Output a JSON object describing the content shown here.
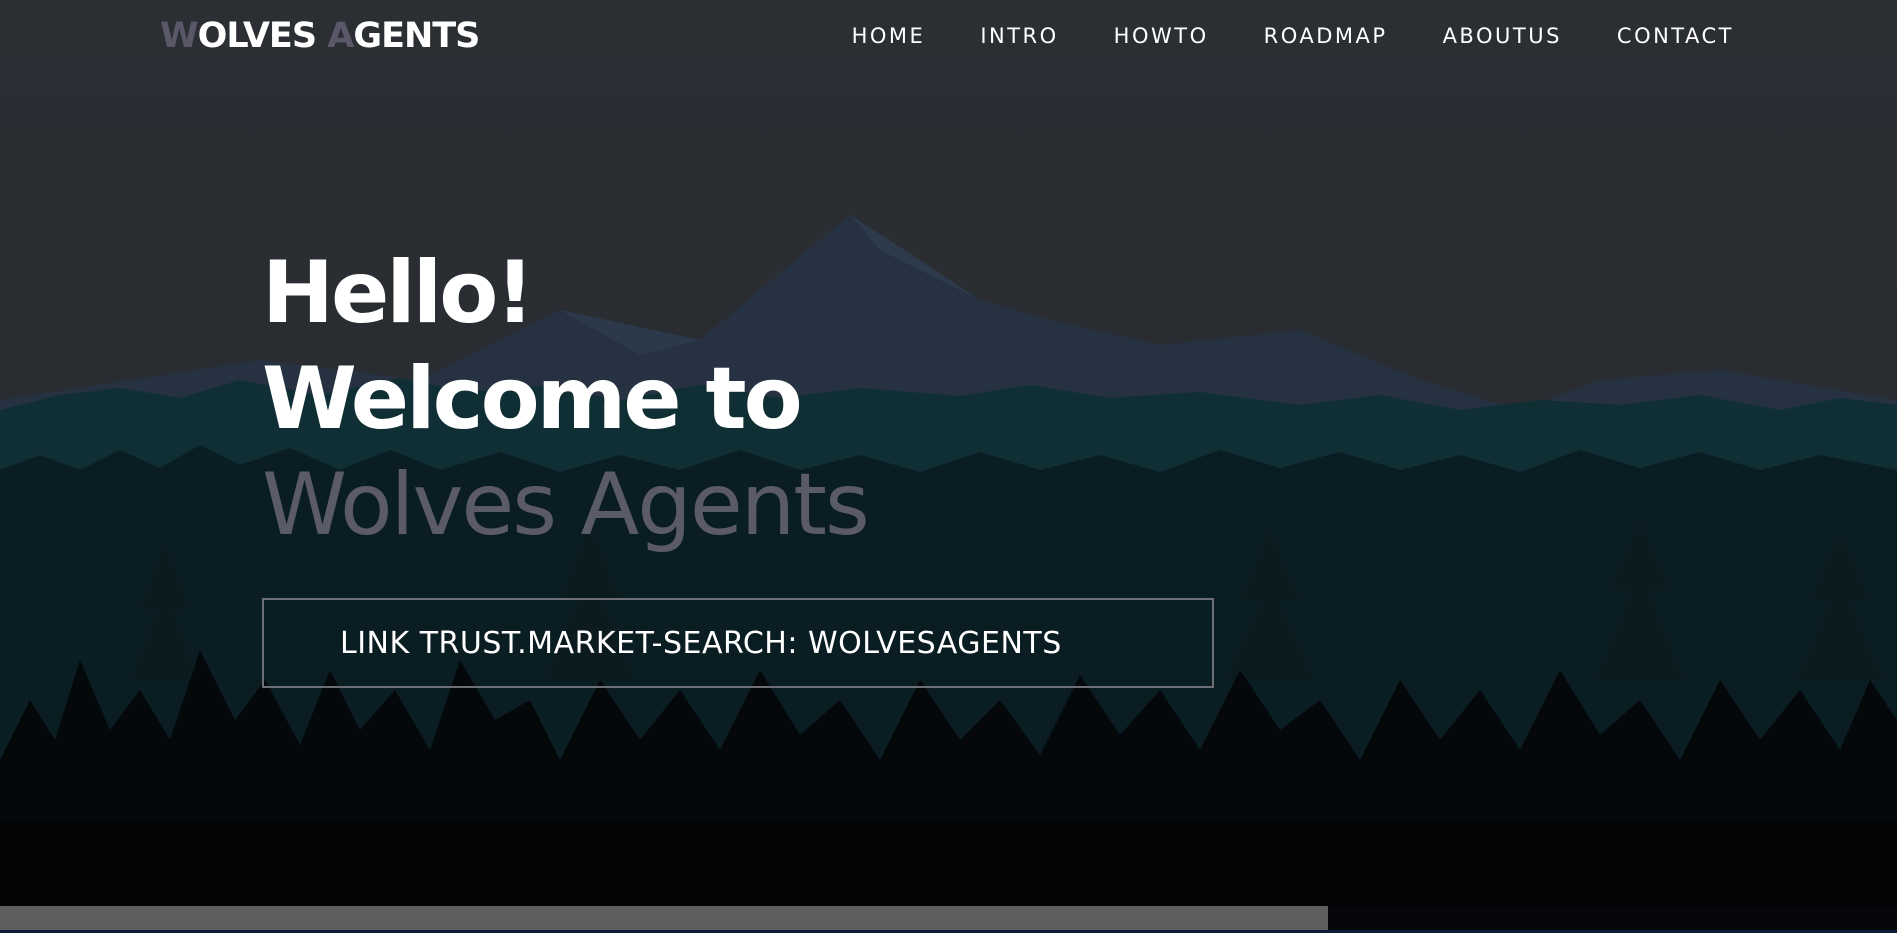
{
  "logo": {
    "part1_initial": "W",
    "part1_rest": "OLVES",
    "part2_initial": "A",
    "part2_rest": "GENTS"
  },
  "nav": {
    "items": [
      "HOME",
      "INTRO",
      "HOWTO",
      "ROADMAP",
      "ABOUTUS",
      "CONTACT"
    ]
  },
  "hero": {
    "line1": "Hello!",
    "line2": "Welcome to",
    "line3": "Wolves Agents"
  },
  "cta": {
    "label": "LINK TRUST.MARKET-SEARCH: WOLVESAGENTS"
  },
  "scroll_progress": 0.7,
  "colors": {
    "background": "#2a2e33",
    "accent_muted": "#5b5a69",
    "text": "#ffffff"
  },
  "icons": [
    "landscape-illustration"
  ]
}
